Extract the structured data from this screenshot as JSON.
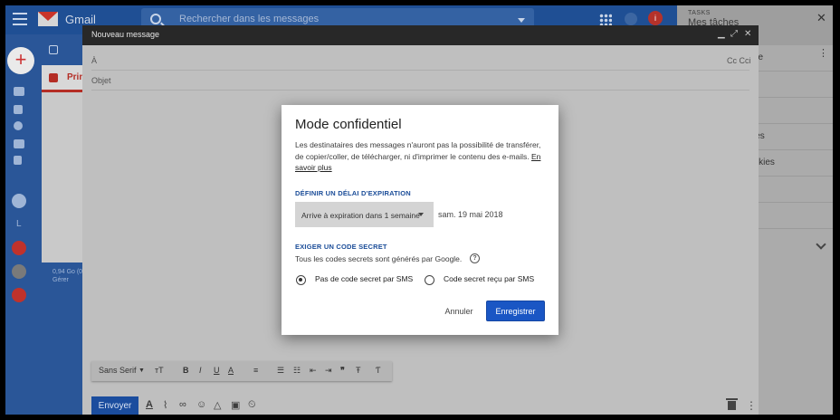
{
  "gmail": {
    "app_name": "Gmail",
    "search_placeholder": "Rechercher dans les messages",
    "avatar_letter": "i",
    "rail_letter": "L",
    "quota_line1": "0,94 Go (0",
    "quota_line2": "Gérer",
    "inbox_tab_label": "Prin",
    "compose_fab": "+"
  },
  "tasks": {
    "kicker": "TASKS",
    "title": "Mes tâches",
    "rows": [
      "che",
      "es",
      "",
      "kies",
      "ookies",
      "",
      ""
    ]
  },
  "compose": {
    "title": "Nouveau message",
    "to_label": "À",
    "cc_label": "Cc Cci",
    "subject_label": "Objet",
    "font_name": "Sans Serif",
    "send_label": "Envoyer"
  },
  "dialog": {
    "title": "Mode confidentiel",
    "description": "Les destinataires des messages n'auront pas la possibilité de transférer, de copier/coller, de télécharger, ni d'imprimer le contenu des e-mails.",
    "learn_more": "En savoir plus",
    "expiry_heading": "DÉFINIR UN DÉLAI D'EXPIRATION",
    "expiry_value": "Arrive à expiration dans 1 semaine",
    "expiry_date": "sam. 19 mai 2018",
    "code_heading": "EXIGER UN CODE SECRET",
    "code_description": "Tous les codes secrets sont générés par Google.",
    "option_no_sms": "Pas de code secret par SMS",
    "option_sms": "Code secret reçu par SMS",
    "cancel_label": "Annuler",
    "save_label": "Enregistrer"
  },
  "colors": {
    "accent": "#1a56c4",
    "section_heading": "#1a4c98",
    "gmail_red": "#c9352a"
  }
}
